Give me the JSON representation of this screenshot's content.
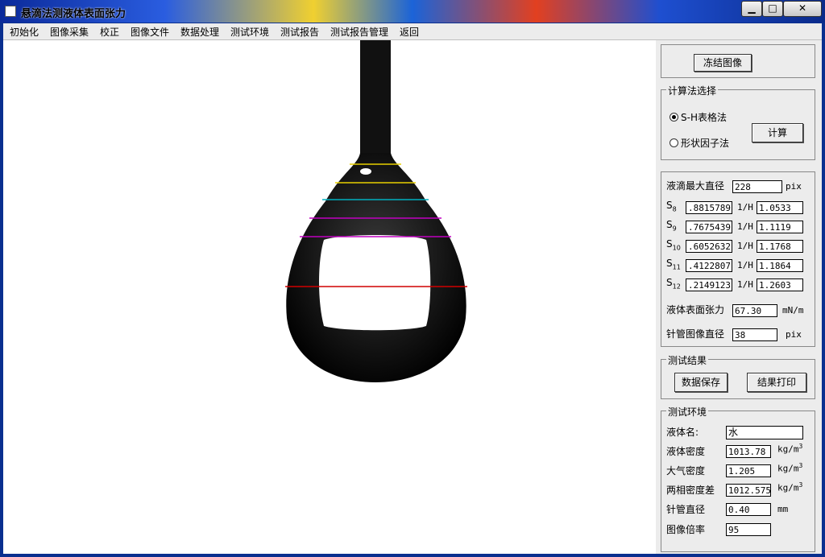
{
  "window": {
    "title": "悬滴法测液体表面张力",
    "minimize": "▁",
    "maximize": "□",
    "close": "✕"
  },
  "menu": [
    "初始化",
    "图像采集",
    "校正",
    "图像文件",
    "数据处理",
    "测试环境",
    "测试报告",
    "测试报告管理",
    "返回"
  ],
  "freeze_button": "冻结图像",
  "method": {
    "legend": "计算法选择",
    "options": [
      {
        "label": "S-H表格法",
        "checked": true
      },
      {
        "label": "形状因子法",
        "checked": false
      }
    ],
    "calc_button": "计算"
  },
  "measure": {
    "max_diameter_label": "液滴最大直径",
    "max_diameter_value": "228",
    "unit_pix": "pix",
    "s_rows": [
      {
        "label": "S",
        "sub": "8",
        "s": ".8815789",
        "h_label": "1/H",
        "h": "1.0533"
      },
      {
        "label": "S",
        "sub": "9",
        "s": ".7675439",
        "h_label": "1/H",
        "h": "1.1119"
      },
      {
        "label": "S",
        "sub": "10",
        "s": ".6052632",
        "h_label": "1/H",
        "h": "1.1768"
      },
      {
        "label": "S",
        "sub": "11",
        "s": ".4122807",
        "h_label": "1/H",
        "h": "1.1864"
      },
      {
        "label": "S",
        "sub": "12",
        "s": ".2149123",
        "h_label": "1/H",
        "h": "1.2603"
      }
    ],
    "tension_label": "液体表面张力",
    "tension_value": "67.30",
    "tension_unit": "mN/m",
    "needle_img_label": "针管图像直径",
    "needle_img_value": "38",
    "needle_img_unit": "pix"
  },
  "result": {
    "legend": "测试结果",
    "save_button": "数据保存",
    "print_button": "结果打印"
  },
  "env": {
    "legend": "测试环境",
    "liquid_name_label": "液体名:",
    "liquid_name_value": "水",
    "liquid_density_label": "液体密度",
    "liquid_density_value": "1013.78",
    "air_density_label": "大气密度",
    "air_density_value": "1.205",
    "diff_density_label": "两相密度差",
    "diff_density_value": "1012.575",
    "density_unit": "kg/m",
    "density_unit_sup": "3",
    "needle_diameter_label": "针管直径",
    "needle_diameter_value": "0.40",
    "needle_diameter_unit": "mm",
    "magnification_label": "图像倍率",
    "magnification_value": "95"
  }
}
